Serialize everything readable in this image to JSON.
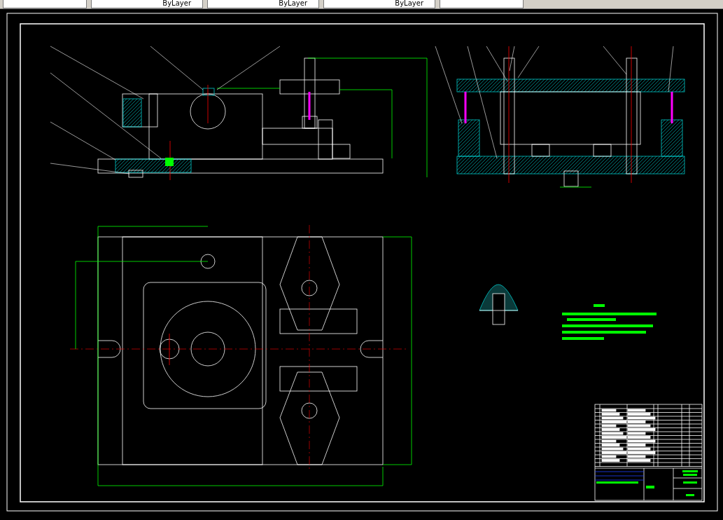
{
  "toolbar": {
    "dropdowns": [
      {
        "kind": "layer"
      },
      {
        "kind": "property",
        "label": "ByLayer"
      },
      {
        "kind": "property",
        "label": "ByLayer"
      },
      {
        "kind": "property",
        "label": "ByLayer"
      },
      {
        "kind": "plot"
      }
    ]
  }
}
